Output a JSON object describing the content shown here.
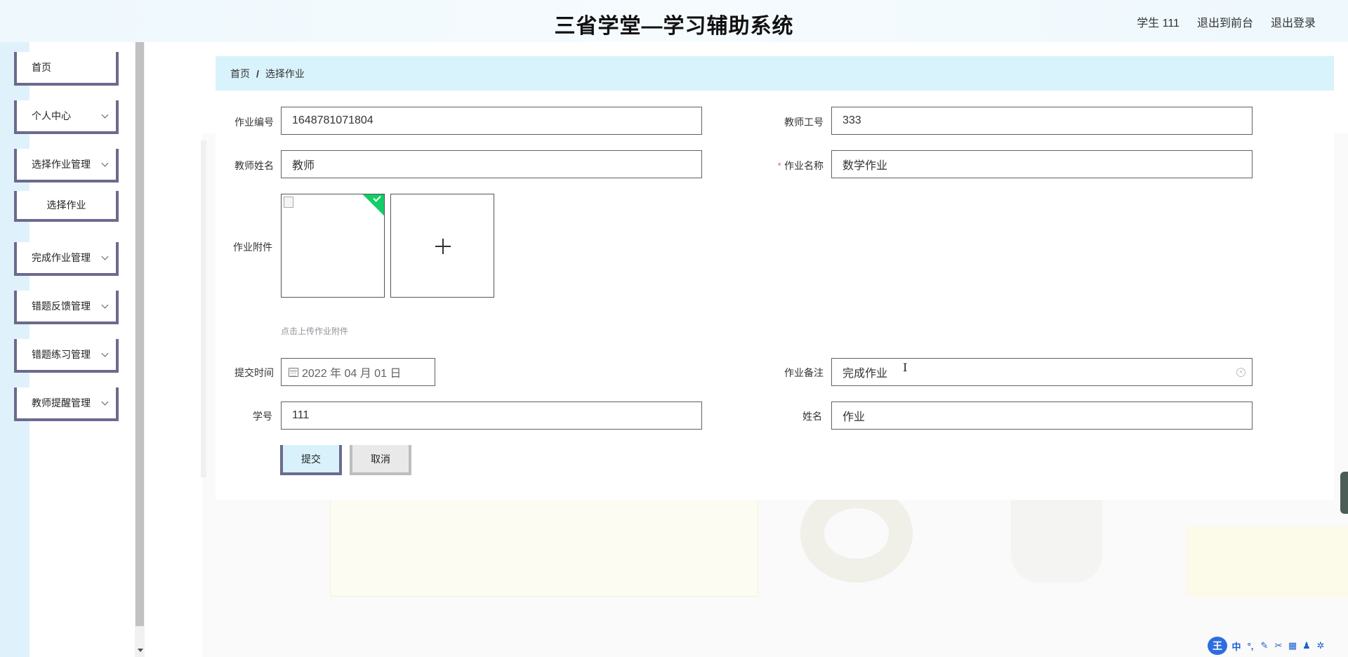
{
  "header": {
    "title": "三省学堂—学习辅助系统",
    "user_label": "学生 111",
    "to_front_label": "退出到前台",
    "logout_label": "退出登录"
  },
  "sidebar": {
    "home": "首页",
    "personal_center": "个人中心",
    "assignment_select_mgmt": "选择作业管理",
    "assignment_select": "选择作业",
    "assignment_done_mgmt": "完成作业管理",
    "wrong_feedback_mgmt": "错题反馈管理",
    "wrong_practice_mgmt": "错题练习管理",
    "teacher_reminder_mgmt": "教师提醒管理"
  },
  "breadcrumb": {
    "home": "首页",
    "separator": "/",
    "current": "选择作业"
  },
  "form": {
    "assignment_no": {
      "label": "作业编号",
      "value": "1648781071804"
    },
    "teacher_id": {
      "label": "教师工号",
      "value": "333"
    },
    "teacher_name": {
      "label": "教师姓名",
      "value": "教师"
    },
    "assignment_name": {
      "label": "作业名称",
      "value": "数学作业",
      "required_mark": "*"
    },
    "attachment": {
      "label": "作业附件",
      "tip": "点击上传作业附件",
      "plus": "+"
    },
    "submit_time": {
      "label": "提交时间",
      "value": "2022 年 04 月 01 日"
    },
    "remark": {
      "label": "作业备注",
      "value": "完成作业"
    },
    "student_no": {
      "label": "学号",
      "value": "111"
    },
    "name": {
      "label": "姓名",
      "value": "作业"
    }
  },
  "buttons": {
    "submit": "提交",
    "cancel": "取消"
  },
  "ime": {
    "logo": "王",
    "lang": "中"
  },
  "colors": {
    "breadcrumb_bg": "#d9f3fc",
    "menu_border": "#6b6a8e",
    "success": "#13ce66",
    "required": "#f56c6c"
  }
}
